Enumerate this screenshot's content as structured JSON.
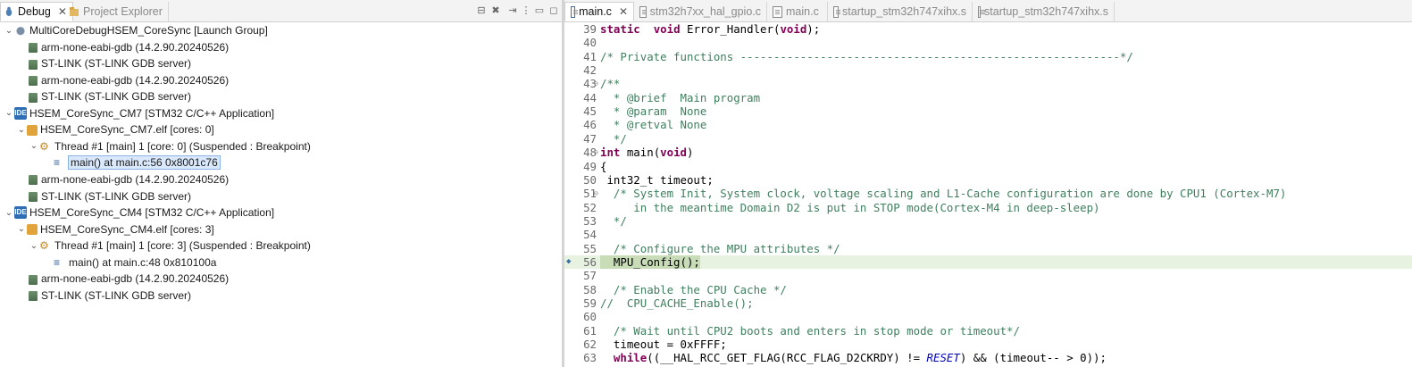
{
  "debug_view": {
    "tabs": [
      {
        "label": "Debug",
        "active": true,
        "icon": "debug-icon"
      },
      {
        "label": "Project Explorer",
        "active": false,
        "icon": "project-explorer-icon"
      }
    ],
    "toolbar_icons": [
      "collapse-all-icon",
      "remove-terminated-icon",
      "step-filter-icon",
      "view-menu-icon",
      "minimize-icon",
      "maximize-icon"
    ],
    "tree": [
      {
        "depth": 0,
        "twisty": "open",
        "icon": "launch-group-icon",
        "label": "MultiCoreDebugHSEM_CoreSync [Launch Group]"
      },
      {
        "depth": 1,
        "twisty": "none",
        "icon": "gdb-process-icon",
        "label": "arm-none-eabi-gdb (14.2.90.20240526)"
      },
      {
        "depth": 1,
        "twisty": "none",
        "icon": "stlink-process-icon",
        "label": "ST-LINK (ST-LINK GDB server)"
      },
      {
        "depth": 1,
        "twisty": "none",
        "icon": "gdb-process-icon",
        "label": "arm-none-eabi-gdb (14.2.90.20240526)"
      },
      {
        "depth": 1,
        "twisty": "none",
        "icon": "stlink-process-icon",
        "label": "ST-LINK (ST-LINK GDB server)"
      },
      {
        "depth": 0,
        "twisty": "open",
        "icon": "stm32-app-icon",
        "label": "HSEM_CoreSync_CM7 [STM32 C/C++ Application]"
      },
      {
        "depth": 1,
        "twisty": "open",
        "icon": "elf-icon",
        "label": "HSEM_CoreSync_CM7.elf [cores: 0]"
      },
      {
        "depth": 2,
        "twisty": "open",
        "icon": "thread-icon",
        "label": "Thread #1 [main] 1 [core: 0] (Suspended : Breakpoint)"
      },
      {
        "depth": 3,
        "twisty": "none",
        "icon": "stack-frame-icon",
        "label": "main() at main.c:56 0x8001c76",
        "selected": true
      },
      {
        "depth": 1,
        "twisty": "none",
        "icon": "gdb-process-icon",
        "label": "arm-none-eabi-gdb (14.2.90.20240526)"
      },
      {
        "depth": 1,
        "twisty": "none",
        "icon": "stlink-process-icon",
        "label": "ST-LINK (ST-LINK GDB server)"
      },
      {
        "depth": 0,
        "twisty": "open",
        "icon": "stm32-app-icon",
        "label": "HSEM_CoreSync_CM4 [STM32 C/C++ Application]"
      },
      {
        "depth": 1,
        "twisty": "open",
        "icon": "elf-icon",
        "label": "HSEM_CoreSync_CM4.elf [cores: 3]"
      },
      {
        "depth": 2,
        "twisty": "open",
        "icon": "thread-icon",
        "label": "Thread #1 [main] 1 [core: 3] (Suspended : Breakpoint)"
      },
      {
        "depth": 3,
        "twisty": "none",
        "icon": "stack-frame-icon",
        "label": "main() at main.c:48 0x810100a"
      },
      {
        "depth": 1,
        "twisty": "none",
        "icon": "gdb-process-icon",
        "label": "arm-none-eabi-gdb (14.2.90.20240526)"
      },
      {
        "depth": 1,
        "twisty": "none",
        "icon": "stlink-process-icon",
        "label": "ST-LINK (ST-LINK GDB server)"
      }
    ]
  },
  "editor": {
    "tabs": [
      {
        "label": "main.c",
        "active": true
      },
      {
        "label": "stm32h7xx_hal_gpio.c",
        "active": false
      },
      {
        "label": "main.c",
        "active": false
      },
      {
        "label": "startup_stm32h747xihx.s",
        "active": false
      },
      {
        "label": "startup_stm32h747xihx.s",
        "active": false
      }
    ],
    "current_line": 56,
    "lines": [
      {
        "n": "39",
        "fold": "",
        "parts": [
          [
            "kw",
            "static"
          ],
          [
            "",
            "  "
          ],
          [
            "kw",
            "void"
          ],
          [
            "",
            " Error_Handler("
          ],
          [
            "kw",
            "void"
          ],
          [
            "",
            ");"
          ]
        ]
      },
      {
        "n": "40",
        "fold": "",
        "parts": []
      },
      {
        "n": "41",
        "fold": "",
        "parts": [
          [
            "cmt",
            "/* Private functions ---------------------------------------------------------*/"
          ]
        ]
      },
      {
        "n": "42",
        "fold": "",
        "parts": []
      },
      {
        "n": "43",
        "fold": "⊖",
        "parts": [
          [
            "cmt",
            "/**"
          ]
        ]
      },
      {
        "n": "44",
        "fold": "",
        "parts": [
          [
            "cmt",
            "  * @brief  Main program"
          ]
        ]
      },
      {
        "n": "45",
        "fold": "",
        "parts": [
          [
            "cmt",
            "  * @param  None"
          ]
        ]
      },
      {
        "n": "46",
        "fold": "",
        "parts": [
          [
            "cmt",
            "  * @retval None"
          ]
        ]
      },
      {
        "n": "47",
        "fold": "",
        "parts": [
          [
            "cmt",
            "  */"
          ]
        ]
      },
      {
        "n": "48",
        "fold": "⊖",
        "parts": [
          [
            "kw",
            "int"
          ],
          [
            "",
            " main("
          ],
          [
            "kw",
            "void"
          ],
          [
            "",
            ")"
          ]
        ]
      },
      {
        "n": "49",
        "fold": "",
        "parts": [
          [
            "",
            "{"
          ]
        ]
      },
      {
        "n": "50",
        "fold": "",
        "parts": [
          [
            "",
            " int32_t timeout;"
          ]
        ]
      },
      {
        "n": "51",
        "fold": "⊖",
        "parts": [
          [
            "cmt",
            "  /* System Init, System clock, voltage scaling and L1-Cache configuration are done by CPU1 (Cortex-M7)"
          ]
        ]
      },
      {
        "n": "52",
        "fold": "",
        "parts": [
          [
            "cmt",
            "     in the meantime Domain D2 is put in STOP mode(Cortex-M4 in deep-sleep)"
          ]
        ]
      },
      {
        "n": "53",
        "fold": "",
        "parts": [
          [
            "cmt",
            "  */"
          ]
        ]
      },
      {
        "n": "54",
        "fold": "",
        "parts": []
      },
      {
        "n": "55",
        "fold": "",
        "parts": [
          [
            "cmt",
            "  /* Configure the MPU attributes */"
          ]
        ]
      },
      {
        "n": "56",
        "fold": "",
        "marker": true,
        "parts": [
          [
            "cur",
            "  MPU_Config();"
          ]
        ]
      },
      {
        "n": "57",
        "fold": "",
        "parts": []
      },
      {
        "n": "58",
        "fold": "",
        "parts": [
          [
            "cmt",
            "  /* Enable the CPU Cache */"
          ]
        ]
      },
      {
        "n": "59",
        "fold": "",
        "parts": [
          [
            "cmt",
            "//  CPU_CACHE_Enable();"
          ]
        ]
      },
      {
        "n": "60",
        "fold": "",
        "parts": []
      },
      {
        "n": "61",
        "fold": "",
        "parts": [
          [
            "cmt",
            "  /* Wait until CPU2 boots and enters in stop mode or timeout*/"
          ]
        ]
      },
      {
        "n": "62",
        "fold": "",
        "parts": [
          [
            "",
            "  timeout = 0xFFFF;"
          ]
        ]
      },
      {
        "n": "63",
        "fold": "",
        "parts": [
          [
            "",
            "  "
          ],
          [
            "kw",
            "while"
          ],
          [
            "",
            "((__HAL_RCC_GET_FLAG(RCC_FLAG_D2CKRDY) != "
          ],
          [
            "mac",
            "RESET"
          ],
          [
            "",
            ") && (timeout-- > 0));"
          ]
        ]
      }
    ]
  }
}
